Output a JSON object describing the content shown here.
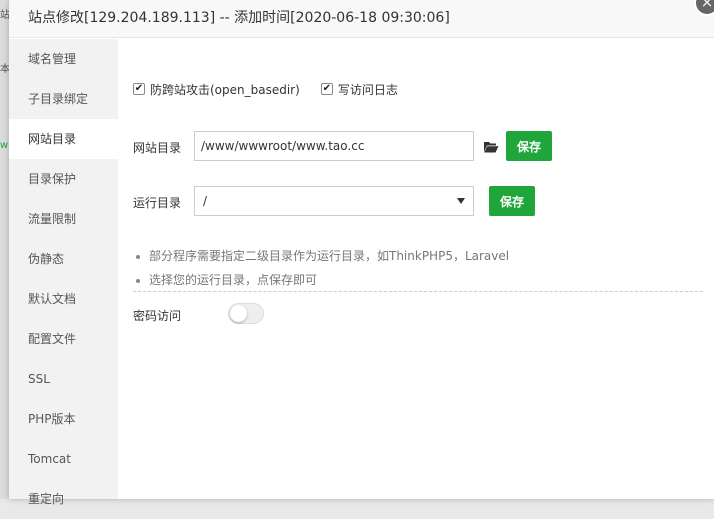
{
  "background_fragments": [
    "站",
    "本",
    "w"
  ],
  "modal": {
    "title": "站点修改[129.204.189.113] -- 添加时间[2020-06-18 09:30:06]",
    "close_glyph": "×"
  },
  "sidebar": {
    "items": [
      {
        "label": "域名管理",
        "active": false
      },
      {
        "label": "子目录绑定",
        "active": false
      },
      {
        "label": "网站目录",
        "active": true
      },
      {
        "label": "目录保护",
        "active": false
      },
      {
        "label": "流量限制",
        "active": false
      },
      {
        "label": "伪静态",
        "active": false
      },
      {
        "label": "默认文档",
        "active": false
      },
      {
        "label": "配置文件",
        "active": false
      },
      {
        "label": "SSL",
        "active": false
      },
      {
        "label": "PHP版本",
        "active": false
      },
      {
        "label": "Tomcat",
        "active": false
      },
      {
        "label": "重定向",
        "active": false
      }
    ]
  },
  "main": {
    "checkbox_openbasedir": {
      "label": "防跨站攻击(open_basedir)",
      "checked": true
    },
    "checkbox_log": {
      "label": "写访问日志",
      "checked": true
    },
    "site_dir": {
      "label": "网站目录",
      "value": "/www/wwwroot/www.tao.cc",
      "save_label": "保存",
      "folder_icon": "folder-open-icon"
    },
    "run_dir": {
      "label": "运行目录",
      "selected": "/",
      "save_label": "保存"
    },
    "tips": [
      "部分程序需要指定二级目录作为运行目录，如ThinkPHP5，Laravel",
      "选择您的运行目录，点保存即可"
    ],
    "password_access": {
      "label": "密码访问",
      "enabled": false
    }
  },
  "colors": {
    "accent_green": "#20a53a",
    "sidebar_bg": "#f2f2f2",
    "header_bg": "#f8f8f8"
  }
}
